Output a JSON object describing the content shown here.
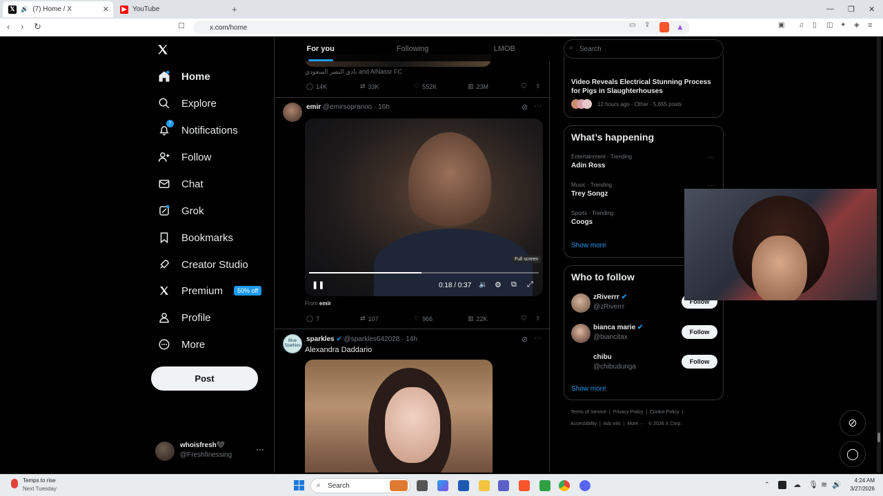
{
  "browser": {
    "tabs": [
      {
        "title": "(7) Home / X",
        "active": true
      },
      {
        "title": "YouTube",
        "active": false
      }
    ],
    "url": "x.com/home"
  },
  "nav": {
    "items": [
      {
        "label": "Home",
        "icon": "home-icon"
      },
      {
        "label": "Explore",
        "icon": "search-icon"
      },
      {
        "label": "Notifications",
        "icon": "bell-icon",
        "badge": "7"
      },
      {
        "label": "Follow",
        "icon": "add-user-icon"
      },
      {
        "label": "Chat",
        "icon": "mail-icon"
      },
      {
        "label": "Grok",
        "icon": "grok-icon"
      },
      {
        "label": "Bookmarks",
        "icon": "bookmark-icon"
      },
      {
        "label": "Creator Studio",
        "icon": "rocket-icon"
      },
      {
        "label": "Premium",
        "icon": "x-logo-icon",
        "tag": "50% off"
      },
      {
        "label": "Profile",
        "icon": "person-icon"
      },
      {
        "label": "More",
        "icon": "more-circle-icon"
      }
    ],
    "post_label": "Post",
    "account": {
      "name": "whoisfresh🖤",
      "handle": "@Freshfinessing"
    }
  },
  "feed": {
    "tabs": [
      "For you",
      "Following",
      "LMOB"
    ],
    "prev_tweet": {
      "caption": "نادي النصر السعودي and AlNassr FC",
      "replies": "14K",
      "reposts": "33K",
      "likes": "552K",
      "views": "23M"
    },
    "tweet1": {
      "name": "emir",
      "handle": "@emirsopranoo",
      "time": "· 16h",
      "video_time": "0:18 / 0:37",
      "progress": 0.49,
      "tooltip": "Full screen",
      "from_label": "From",
      "from_user": "emir",
      "replies": "7",
      "reposts": "107",
      "likes": "966",
      "views": "22K"
    },
    "tweet2": {
      "name": "sparkles",
      "handle": "@sparkles642028",
      "time": "· 14h",
      "text": "Alexandra Daddario",
      "avatar_text": "Blue Sparkles"
    }
  },
  "right": {
    "search_placeholder": "Search",
    "news": {
      "title": "Video Reveals Electrical Stunning Process for Pigs in Slaughterhouses",
      "meta": "12 hours ago · Other · 5,655 posts"
    },
    "happening": {
      "title": "What’s happening",
      "trends": [
        {
          "context": "Entertainment · Trending",
          "name": "Adin Ross"
        },
        {
          "context": "Music · Trending",
          "name": "Trey Songz"
        },
        {
          "context": "Sports · Trending",
          "name": "Coogs"
        }
      ],
      "show_more": "Show more"
    },
    "who_to_follow": {
      "title": "Who to follow",
      "users": [
        {
          "name": "zRiverrr",
          "handle": "@zRiverrr"
        },
        {
          "name": "bianca marie",
          "handle": "@biancitax"
        },
        {
          "name": "chibu",
          "handle": "@chibudunga"
        }
      ],
      "follow_label": "Follow",
      "show_more": "Show more"
    },
    "footer": {
      "line1": [
        "Terms of Service",
        "Privacy Policy",
        "Cookie Policy"
      ],
      "line2": [
        "Accessibility",
        "Ads info",
        "More ···",
        "© 2026 X Corp."
      ]
    }
  },
  "taskbar": {
    "weather_title": "Temps to rise",
    "weather_sub": "Next Tuesday",
    "search_label": "Search",
    "time": "4:24 AM",
    "date": "3/27/2026"
  }
}
